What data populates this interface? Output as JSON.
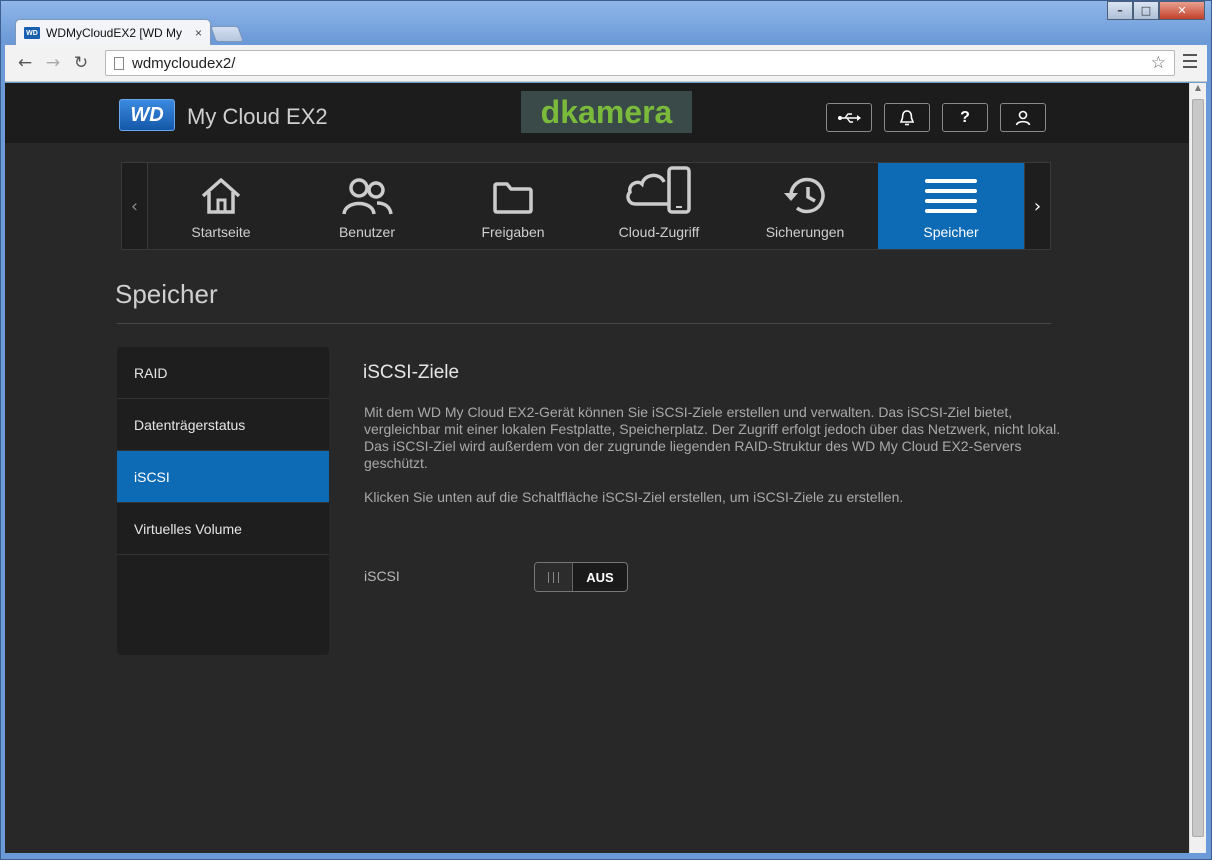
{
  "browser": {
    "tab_title": "WDMyCloudEX2 [WD My",
    "tab_close": "×",
    "url": "wdmycloudex2/",
    "window_buttons": {
      "minimize": "–",
      "maximize": "□",
      "close": "✕"
    },
    "nav": {
      "back": "←",
      "forward": "→",
      "reload": "↻"
    },
    "star": "☆"
  },
  "header": {
    "logo": "WD",
    "product_name": "My Cloud EX2",
    "brand": "dkamera",
    "icons": [
      "usb-icon",
      "bell-icon",
      "help-icon",
      "user-icon"
    ],
    "help_label": "?"
  },
  "navbar": {
    "prev": "‹",
    "next": "›",
    "items": [
      {
        "label": "Startseite",
        "icon": "home-icon"
      },
      {
        "label": "Benutzer",
        "icon": "users-icon"
      },
      {
        "label": "Freigaben",
        "icon": "folder-icon"
      },
      {
        "label": "Cloud-Zugriff",
        "icon": "cloud-access-icon"
      },
      {
        "label": "Sicherungen",
        "icon": "history-icon"
      },
      {
        "label": "Speicher",
        "icon": "storage-icon",
        "active": true
      }
    ]
  },
  "page": {
    "title": "Speicher"
  },
  "sidebar": {
    "items": [
      {
        "label": "RAID"
      },
      {
        "label": "Datenträgerstatus"
      },
      {
        "label": "iSCSI",
        "active": true
      },
      {
        "label": "Virtuelles Volume"
      }
    ]
  },
  "content": {
    "heading": "iSCSI-Ziele",
    "description": "Mit dem WD My Cloud EX2-Gerät können Sie iSCSI-Ziele erstellen und verwalten. Das iSCSI-Ziel bietet, vergleichbar mit einer lokalen Festplatte, Speicherplatz. Der Zugriff erfolgt jedoch über das Netzwerk, nicht lokal. Das iSCSI-Ziel wird außerdem von der zugrunde liegenden RAID-Struktur des WD My Cloud EX2-Servers geschützt.",
    "instruction": "Klicken Sie unten auf die Schaltfläche iSCSI-Ziel erstellen, um iSCSI-Ziele zu erstellen.",
    "toggle_label": "iSCSI",
    "toggle_state": "AUS"
  },
  "colors": {
    "accent": "#0d6ab5",
    "background": "#282828",
    "header_bg": "#1c1c1c",
    "brand_green": "#7bbb3c"
  }
}
